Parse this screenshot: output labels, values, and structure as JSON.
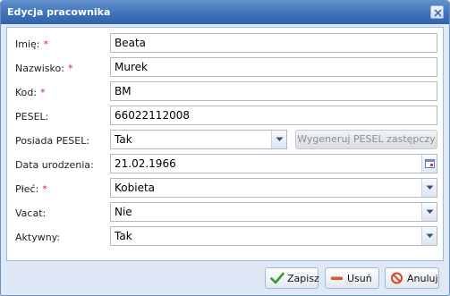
{
  "dialog": {
    "title": "Edycja pracownika"
  },
  "form": {
    "imie": {
      "label": "Imię:",
      "required": "*",
      "value": "Beata"
    },
    "nazwisko": {
      "label": "Nazwisko:",
      "required": "*",
      "value": "Murek"
    },
    "kod": {
      "label": "Kod:",
      "required": "*",
      "value": "BM"
    },
    "pesel": {
      "label": "PESEL:",
      "value": "66022112008"
    },
    "posiada_pesel": {
      "label": "Posiada PESEL:",
      "value": "Tak",
      "generate_label": "Wygeneruj PESEL zastępczy"
    },
    "data_urodzenia": {
      "label": "Data urodzenia:",
      "value": "21.02.1966"
    },
    "plec": {
      "label": "Płeć:",
      "required": "*",
      "value": "Kobieta"
    },
    "vacat": {
      "label": "Vacat:",
      "value": "Nie"
    },
    "aktywny": {
      "label": "Aktywny:",
      "value": "Tak"
    }
  },
  "buttons": {
    "save": "Zapisz",
    "delete": "Usuń",
    "cancel": "Anuluj"
  },
  "colors": {
    "titlebar": "#3d70b6",
    "required": "#e02020",
    "disabled_text": "#8a8f99"
  }
}
